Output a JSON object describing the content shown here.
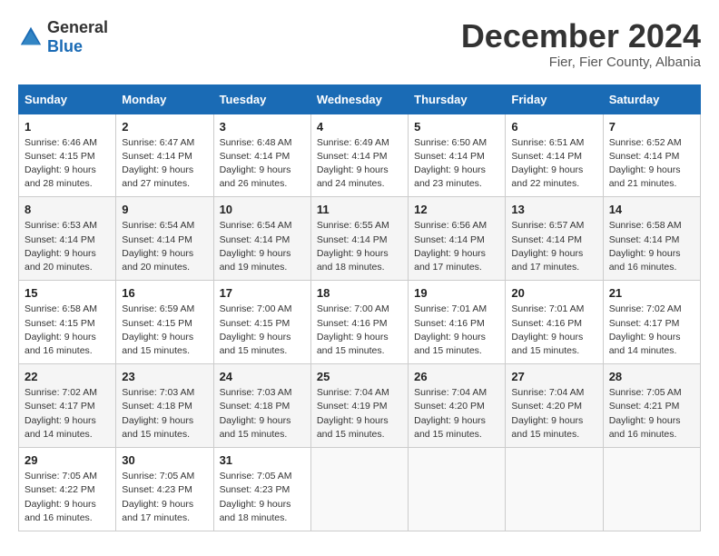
{
  "logo": {
    "general": "General",
    "blue": "Blue"
  },
  "title": "December 2024",
  "subtitle": "Fier, Fier County, Albania",
  "days_of_week": [
    "Sunday",
    "Monday",
    "Tuesday",
    "Wednesday",
    "Thursday",
    "Friday",
    "Saturday"
  ],
  "weeks": [
    [
      {
        "day": "1",
        "sunrise": "Sunrise: 6:46 AM",
        "sunset": "Sunset: 4:15 PM",
        "daylight": "Daylight: 9 hours and 28 minutes."
      },
      {
        "day": "2",
        "sunrise": "Sunrise: 6:47 AM",
        "sunset": "Sunset: 4:14 PM",
        "daylight": "Daylight: 9 hours and 27 minutes."
      },
      {
        "day": "3",
        "sunrise": "Sunrise: 6:48 AM",
        "sunset": "Sunset: 4:14 PM",
        "daylight": "Daylight: 9 hours and 26 minutes."
      },
      {
        "day": "4",
        "sunrise": "Sunrise: 6:49 AM",
        "sunset": "Sunset: 4:14 PM",
        "daylight": "Daylight: 9 hours and 24 minutes."
      },
      {
        "day": "5",
        "sunrise": "Sunrise: 6:50 AM",
        "sunset": "Sunset: 4:14 PM",
        "daylight": "Daylight: 9 hours and 23 minutes."
      },
      {
        "day": "6",
        "sunrise": "Sunrise: 6:51 AM",
        "sunset": "Sunset: 4:14 PM",
        "daylight": "Daylight: 9 hours and 22 minutes."
      },
      {
        "day": "7",
        "sunrise": "Sunrise: 6:52 AM",
        "sunset": "Sunset: 4:14 PM",
        "daylight": "Daylight: 9 hours and 21 minutes."
      }
    ],
    [
      {
        "day": "8",
        "sunrise": "Sunrise: 6:53 AM",
        "sunset": "Sunset: 4:14 PM",
        "daylight": "Daylight: 9 hours and 20 minutes."
      },
      {
        "day": "9",
        "sunrise": "Sunrise: 6:54 AM",
        "sunset": "Sunset: 4:14 PM",
        "daylight": "Daylight: 9 hours and 20 minutes."
      },
      {
        "day": "10",
        "sunrise": "Sunrise: 6:54 AM",
        "sunset": "Sunset: 4:14 PM",
        "daylight": "Daylight: 9 hours and 19 minutes."
      },
      {
        "day": "11",
        "sunrise": "Sunrise: 6:55 AM",
        "sunset": "Sunset: 4:14 PM",
        "daylight": "Daylight: 9 hours and 18 minutes."
      },
      {
        "day": "12",
        "sunrise": "Sunrise: 6:56 AM",
        "sunset": "Sunset: 4:14 PM",
        "daylight": "Daylight: 9 hours and 17 minutes."
      },
      {
        "day": "13",
        "sunrise": "Sunrise: 6:57 AM",
        "sunset": "Sunset: 4:14 PM",
        "daylight": "Daylight: 9 hours and 17 minutes."
      },
      {
        "day": "14",
        "sunrise": "Sunrise: 6:58 AM",
        "sunset": "Sunset: 4:14 PM",
        "daylight": "Daylight: 9 hours and 16 minutes."
      }
    ],
    [
      {
        "day": "15",
        "sunrise": "Sunrise: 6:58 AM",
        "sunset": "Sunset: 4:15 PM",
        "daylight": "Daylight: 9 hours and 16 minutes."
      },
      {
        "day": "16",
        "sunrise": "Sunrise: 6:59 AM",
        "sunset": "Sunset: 4:15 PM",
        "daylight": "Daylight: 9 hours and 15 minutes."
      },
      {
        "day": "17",
        "sunrise": "Sunrise: 7:00 AM",
        "sunset": "Sunset: 4:15 PM",
        "daylight": "Daylight: 9 hours and 15 minutes."
      },
      {
        "day": "18",
        "sunrise": "Sunrise: 7:00 AM",
        "sunset": "Sunset: 4:16 PM",
        "daylight": "Daylight: 9 hours and 15 minutes."
      },
      {
        "day": "19",
        "sunrise": "Sunrise: 7:01 AM",
        "sunset": "Sunset: 4:16 PM",
        "daylight": "Daylight: 9 hours and 15 minutes."
      },
      {
        "day": "20",
        "sunrise": "Sunrise: 7:01 AM",
        "sunset": "Sunset: 4:16 PM",
        "daylight": "Daylight: 9 hours and 15 minutes."
      },
      {
        "day": "21",
        "sunrise": "Sunrise: 7:02 AM",
        "sunset": "Sunset: 4:17 PM",
        "daylight": "Daylight: 9 hours and 14 minutes."
      }
    ],
    [
      {
        "day": "22",
        "sunrise": "Sunrise: 7:02 AM",
        "sunset": "Sunset: 4:17 PM",
        "daylight": "Daylight: 9 hours and 14 minutes."
      },
      {
        "day": "23",
        "sunrise": "Sunrise: 7:03 AM",
        "sunset": "Sunset: 4:18 PM",
        "daylight": "Daylight: 9 hours and 15 minutes."
      },
      {
        "day": "24",
        "sunrise": "Sunrise: 7:03 AM",
        "sunset": "Sunset: 4:18 PM",
        "daylight": "Daylight: 9 hours and 15 minutes."
      },
      {
        "day": "25",
        "sunrise": "Sunrise: 7:04 AM",
        "sunset": "Sunset: 4:19 PM",
        "daylight": "Daylight: 9 hours and 15 minutes."
      },
      {
        "day": "26",
        "sunrise": "Sunrise: 7:04 AM",
        "sunset": "Sunset: 4:20 PM",
        "daylight": "Daylight: 9 hours and 15 minutes."
      },
      {
        "day": "27",
        "sunrise": "Sunrise: 7:04 AM",
        "sunset": "Sunset: 4:20 PM",
        "daylight": "Daylight: 9 hours and 15 minutes."
      },
      {
        "day": "28",
        "sunrise": "Sunrise: 7:05 AM",
        "sunset": "Sunset: 4:21 PM",
        "daylight": "Daylight: 9 hours and 16 minutes."
      }
    ],
    [
      {
        "day": "29",
        "sunrise": "Sunrise: 7:05 AM",
        "sunset": "Sunset: 4:22 PM",
        "daylight": "Daylight: 9 hours and 16 minutes."
      },
      {
        "day": "30",
        "sunrise": "Sunrise: 7:05 AM",
        "sunset": "Sunset: 4:23 PM",
        "daylight": "Daylight: 9 hours and 17 minutes."
      },
      {
        "day": "31",
        "sunrise": "Sunrise: 7:05 AM",
        "sunset": "Sunset: 4:23 PM",
        "daylight": "Daylight: 9 hours and 18 minutes."
      },
      null,
      null,
      null,
      null
    ]
  ]
}
